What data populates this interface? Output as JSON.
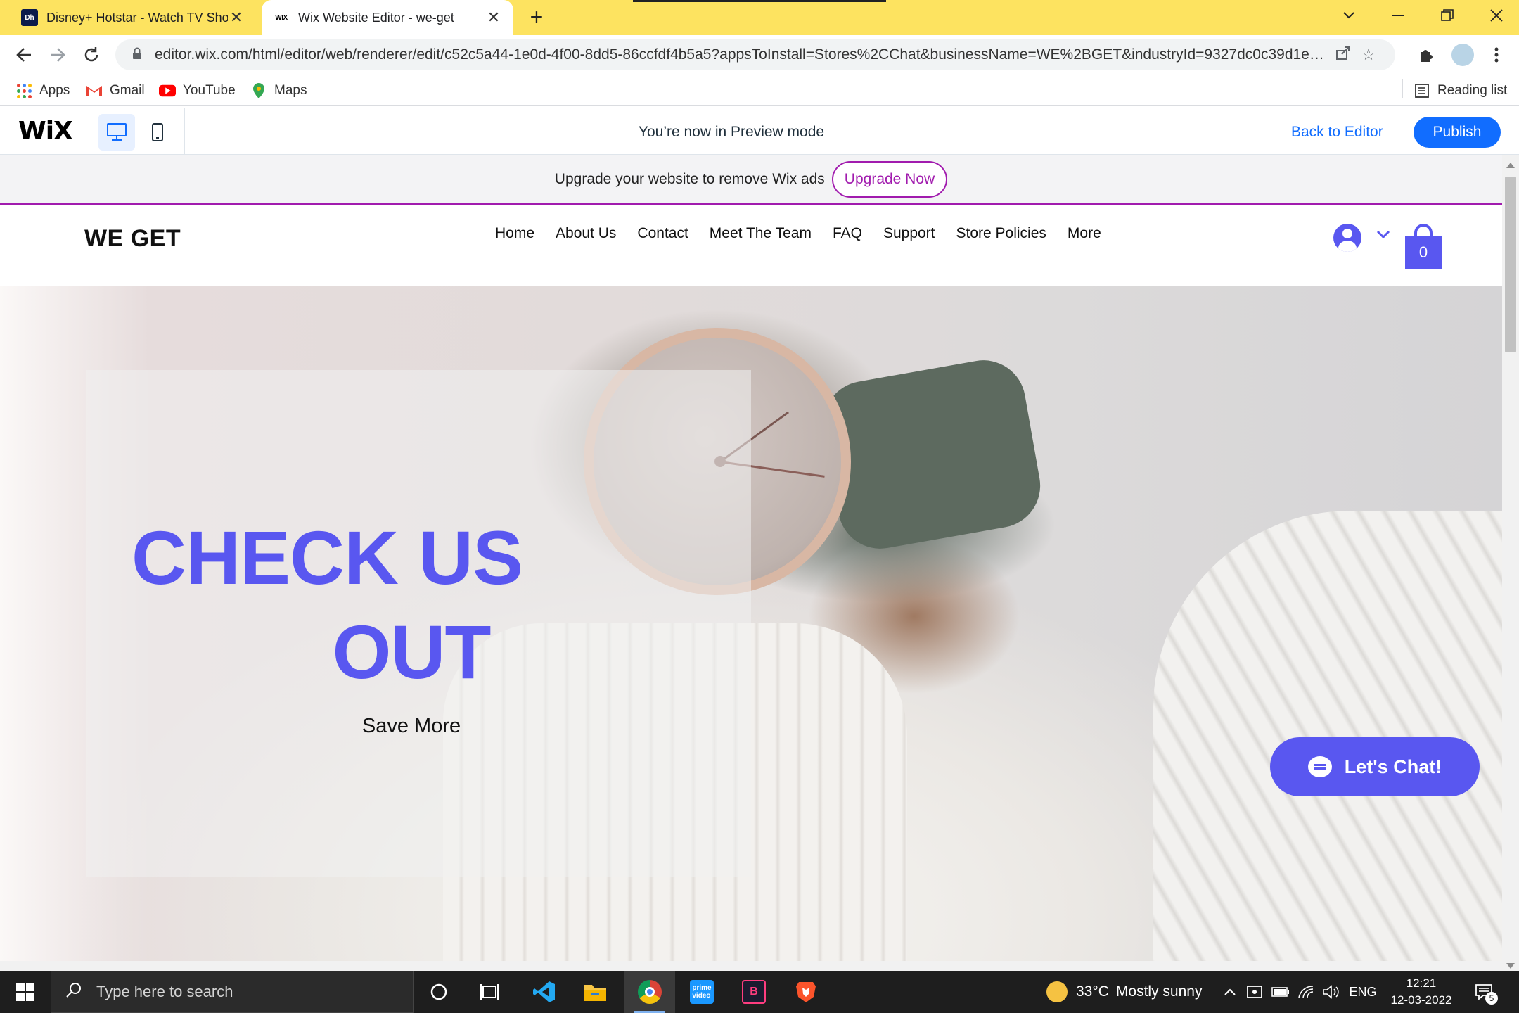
{
  "browser": {
    "tabs": [
      {
        "title": "Disney+ Hotstar - Watch TV Sho",
        "favicon": "hotstar-icon",
        "active": false
      },
      {
        "title": "Wix Website Editor - we-get",
        "favicon": "wix-icon",
        "active": true
      }
    ],
    "url": "editor.wix.com/html/editor/web/renderer/edit/c52c5a44-1e0d-4f00-8dd5-86ccfdf4b5a5?appsToInstall=Stores%2CChat&businessName=WE%2BGET&industryId=9327dc0c39d1ecc...",
    "bookmarks": [
      {
        "label": "Apps",
        "icon": "apps-grid-icon"
      },
      {
        "label": "Gmail",
        "icon": "gmail-icon"
      },
      {
        "label": "YouTube",
        "icon": "youtube-icon"
      },
      {
        "label": "Maps",
        "icon": "maps-icon"
      }
    ],
    "reading_list": "Reading list"
  },
  "wix_bar": {
    "logo": "WiX",
    "preview_message": "You’re now in Preview mode",
    "back_to_editor": "Back to Editor",
    "publish": "Publish"
  },
  "ad_bar": {
    "text": "Upgrade your website to remove Wix ads",
    "button": "Upgrade Now"
  },
  "site": {
    "brand": "WE GET",
    "menu": [
      "Home",
      "About Us",
      "Contact",
      "Meet The Team",
      "FAQ",
      "Support",
      "Store Policies",
      "More"
    ],
    "cart_count": "0",
    "hero": {
      "line1": "CHECK US",
      "line2": "OUT",
      "subtitle": "Save More"
    },
    "chat_button": "Let's Chat!",
    "accent_color": "#5957f0",
    "ad_color": "#a11bae"
  },
  "taskbar": {
    "search_placeholder": "Type here to search",
    "weather_temp": "33°C",
    "weather_desc": "Mostly sunny",
    "language": "ENG",
    "time": "12:21",
    "date": "12-03-2022",
    "notification_count": "5"
  }
}
